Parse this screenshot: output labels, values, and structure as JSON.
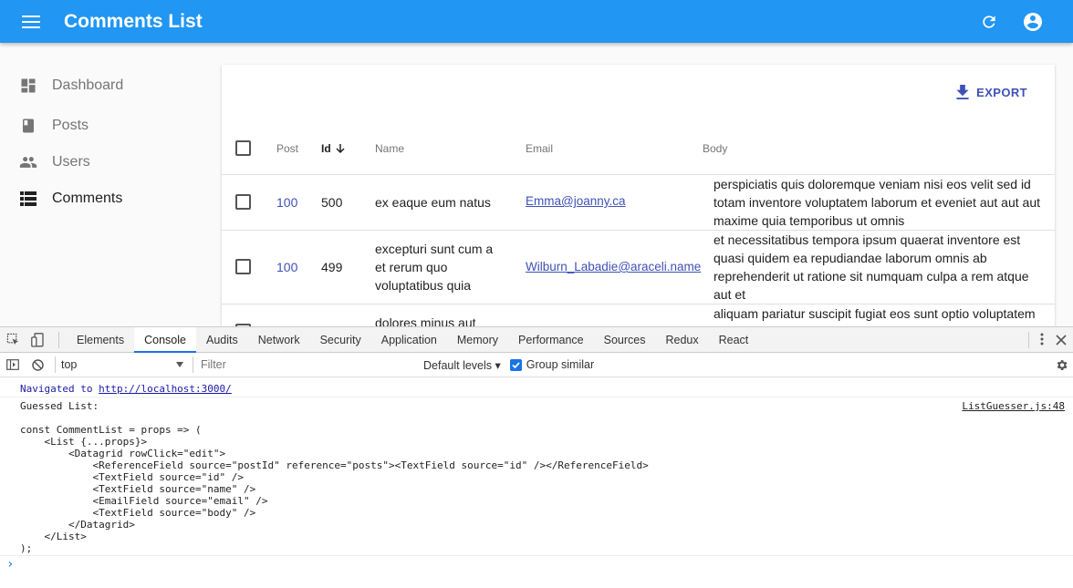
{
  "appbar": {
    "title": "Comments List",
    "bg": "#2196f3"
  },
  "sidebar": {
    "items": [
      {
        "label": "Dashboard",
        "icon": "dashboard-icon"
      },
      {
        "label": "Posts",
        "icon": "book-icon"
      },
      {
        "label": "Users",
        "icon": "people-icon"
      },
      {
        "label": "Comments",
        "icon": "list-icon",
        "active": true
      }
    ]
  },
  "list": {
    "export_label": "EXPORT",
    "columns": [
      "Post",
      "Id",
      "Name",
      "Email",
      "Body"
    ],
    "rows": [
      {
        "post": "100",
        "id": "500",
        "name": [
          "ex eaque eum natus"
        ],
        "email": "Emma@joanny.ca",
        "body": [
          "perspiciatis quis doloremque veniam nisi eos velit sed id",
          "totam inventore voluptatem laborum et eveniet aut aut aut",
          "maxime quia temporibus ut omnis"
        ]
      },
      {
        "post": "100",
        "id": "499",
        "name": [
          "excepturi sunt cum a",
          "et rerum quo",
          "voluptatibus quia"
        ],
        "email": "Wilburn_Labadie@araceli.name",
        "body": [
          "et necessitatibus tempora ipsum quaerat inventore est",
          "quasi quidem ea repudiandae laborum omnis ab",
          "reprehenderit ut ratione sit numquam culpa a rem atque",
          "aut et"
        ]
      },
      {
        "name": [
          "dolores minus aut"
        ],
        "body": [
          "aliquam pariatur suscipit fugiat eos sunt optio voluptatem"
        ]
      }
    ]
  },
  "devtools": {
    "tabs": [
      "Elements",
      "Console",
      "Audits",
      "Network",
      "Security",
      "Application",
      "Memory",
      "Performance",
      "Sources",
      "Redux",
      "React"
    ],
    "active_tab": "Console",
    "context": "top",
    "filter_placeholder": "Filter",
    "levels": "Default levels ▾",
    "group_similar": "Group similar",
    "console": {
      "navigated_prefix": "Navigated to ",
      "navigated_url": "http://localhost:3000/",
      "source_link": "ListGuesser.js:48",
      "code_lines": [
        "Guessed List:",
        "",
        "const CommentList = props => (",
        "    <List {...props}>",
        "        <Datagrid rowClick=\"edit\">",
        "            <ReferenceField source=\"postId\" reference=\"posts\"><TextField source=\"id\" /></ReferenceField>",
        "            <TextField source=\"id\" />",
        "            <TextField source=\"name\" />",
        "            <EmailField source=\"email\" />",
        "            <TextField source=\"body\" />",
        "        </Datagrid>",
        "    </List>",
        ");"
      ],
      "prompt": "›"
    }
  }
}
